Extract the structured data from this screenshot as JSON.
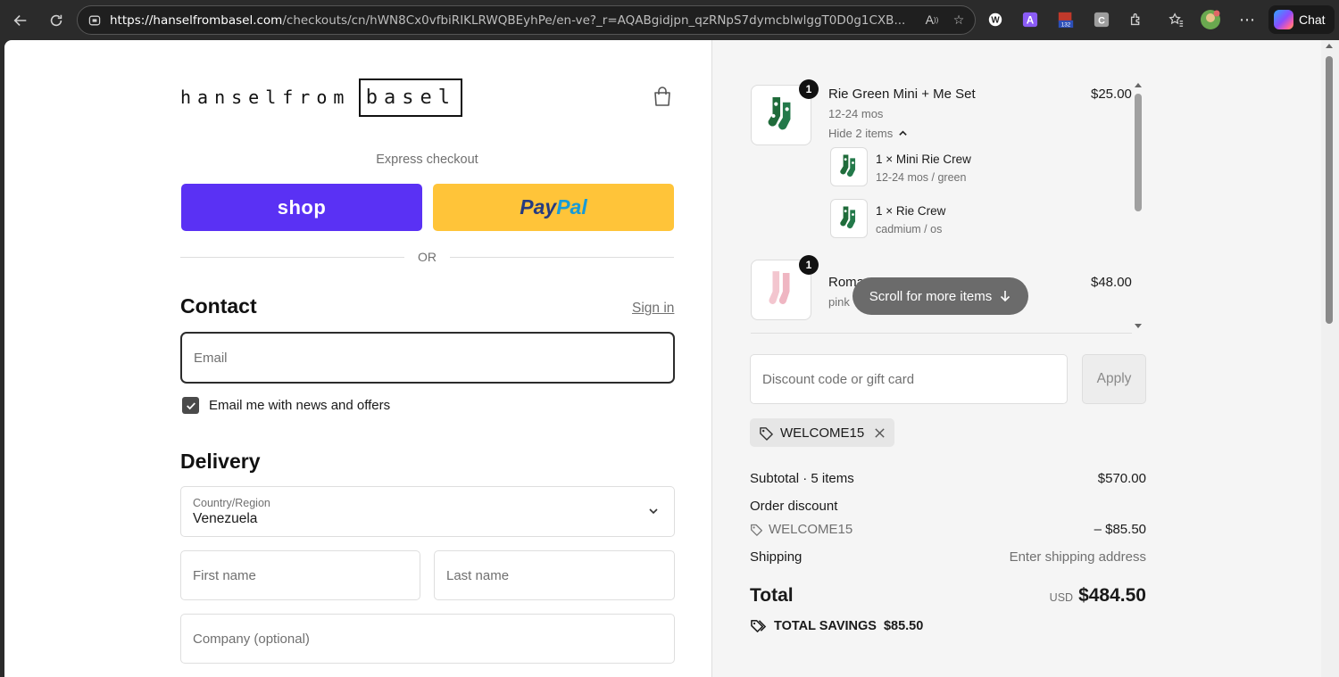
{
  "browser": {
    "url_host": "https://hanselfrombasel.com",
    "url_rest": "/checkouts/cn/hWN8Cx0vfbiRIKLRWQBEyhPe/en-ve?_r=AQABgidjpn_qzRNpS7dymcblwlggT0D0g1CXB...",
    "ext_badge": "132",
    "chat_label": "Chat"
  },
  "store": {
    "logo_left": "hanselfrom",
    "logo_right": "basel"
  },
  "checkout": {
    "express_label": "Express checkout",
    "shop_label": "shop",
    "paypal_pay": "Pay",
    "paypal_pal": "Pal",
    "or_label": "OR",
    "contact_heading": "Contact",
    "sign_in": "Sign in",
    "email_placeholder": "Email",
    "news_label": "Email me with news and offers",
    "delivery_heading": "Delivery",
    "country_label": "Country/Region",
    "country_value": "Venezuela",
    "first_name": "First name",
    "last_name": "Last name",
    "company": "Company (optional)"
  },
  "cart": {
    "items": [
      {
        "qty": "1",
        "name": "Rie Green Mini + Me Set",
        "variant": "12-24 mos",
        "toggle": "Hide 2 items",
        "price": "$25.00",
        "subitems": [
          {
            "name": "1 × Mini Rie Crew",
            "variant": "12-24 mos / green"
          },
          {
            "name": "1 × Rie Crew",
            "variant": "cadmium / os"
          }
        ]
      },
      {
        "qty": "1",
        "name": "Roma",
        "variant": "pink",
        "price": "$48.00"
      }
    ],
    "scroll_hint": "Scroll for more items",
    "discount_placeholder": "Discount code or gift card",
    "apply_label": "Apply",
    "applied_code": "WELCOME15"
  },
  "summary": {
    "subtotal_label": "Subtotal · 5 items",
    "subtotal_value": "$570.00",
    "order_discount_label": "Order discount",
    "discount_code": "WELCOME15",
    "discount_value": "– $85.50",
    "shipping_label": "Shipping",
    "shipping_value": "Enter shipping address",
    "total_label": "Total",
    "currency": "USD",
    "total_value": "$484.50",
    "savings_label": "TOTAL SAVINGS",
    "savings_value": "$85.50"
  },
  "colors": {
    "shop_purple": "#5a31f4",
    "paypal_yellow": "#ffc439",
    "sock_green": "#1f6b3a",
    "sock_pink": "#f3c6cf"
  }
}
